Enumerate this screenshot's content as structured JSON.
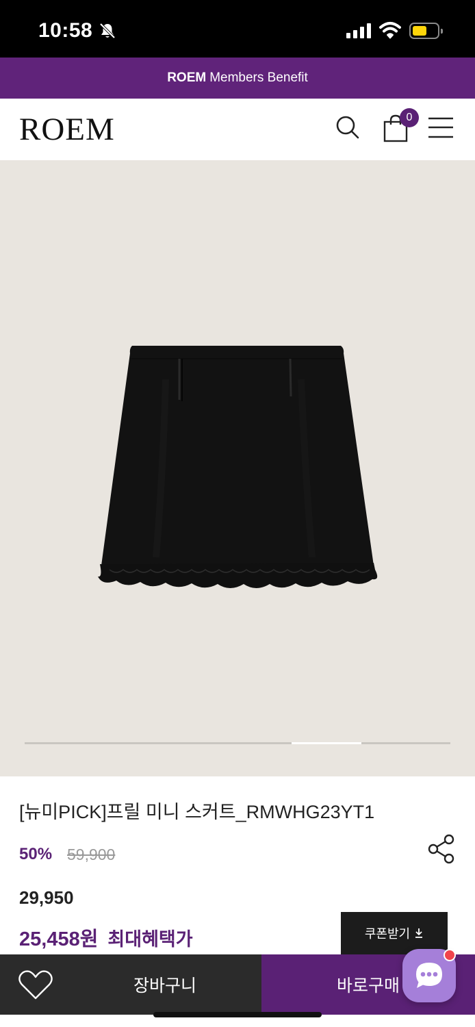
{
  "status_bar": {
    "time": "10:58"
  },
  "promo": {
    "brand": "ROEM",
    "text": "Members Benefit"
  },
  "header": {
    "logo": "ROEM",
    "cart_count": "0"
  },
  "product": {
    "name": "[뉴미PICK]프릴 미니 스커트_RMWHG23YT1",
    "discount_rate": "50%",
    "original_price": "59,900",
    "sale_price": "29,950",
    "benefit_price": "25,458원",
    "benefit_label": "최대혜택가",
    "image_slide_position": 0.75
  },
  "actions": {
    "coupon": "쿠폰받기",
    "cart": "장바구니",
    "buy": "바로구매"
  },
  "icons": [
    "bell-slash-icon",
    "search-icon",
    "shopping-bag-icon",
    "menu-icon",
    "share-icon",
    "heart-icon",
    "chat-icon",
    "download-icon"
  ],
  "colors": {
    "brand_purple": "#5a2175",
    "banner_purple": "#60237a",
    "image_bg": "#e9e5df",
    "dark_bar": "#2b2b2b"
  }
}
